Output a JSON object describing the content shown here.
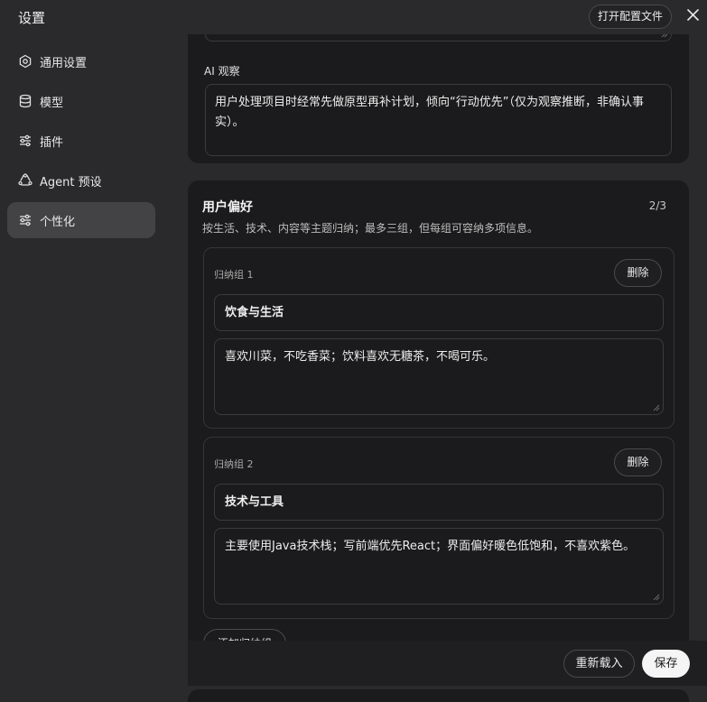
{
  "window": {
    "title": "设置",
    "open_config_label": "打开配置文件"
  },
  "sidebar": {
    "items": [
      {
        "label": "通用设置",
        "icon": "gear-icon"
      },
      {
        "label": "模型",
        "icon": "database-icon"
      },
      {
        "label": "插件",
        "icon": "sliders-icon"
      },
      {
        "label": "Agent 预设",
        "icon": "recycle-icon"
      },
      {
        "label": "个性化",
        "icon": "sliders-icon",
        "active": true
      }
    ]
  },
  "ai_observation": {
    "label": "AI 观察",
    "value": "用户处理项目时经常先做原型再补计划，倾向“行动优先”（仅为观察推断，非确认事实）。"
  },
  "preferences": {
    "title": "用户偏好",
    "count": "2/3",
    "description": "按生活、技术、内容等主题归纳；最多三组，但每组可容纳多项信息。",
    "groups": [
      {
        "label": "归纳组 1",
        "delete_label": "删除",
        "name": "饮食与生活",
        "text": "喜欢川菜，不吃香菜；饮料喜欢无糖茶，不喝可乐。"
      },
      {
        "label": "归纳组 2",
        "delete_label": "删除",
        "name": "技术与工具",
        "text": "主要使用Java技术栈；写前端优先React；界面偏好暖色低饱和，不喜欢紫色。"
      }
    ],
    "add_label": "添加归纳组"
  },
  "footer": {
    "reload_label": "重新载入",
    "save_label": "保存"
  }
}
